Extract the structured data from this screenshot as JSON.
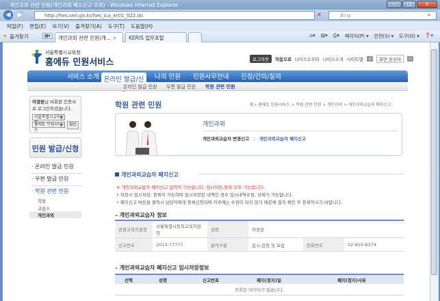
{
  "window": {
    "title": "개인과외 관련 민원(개인과외 폐소신고 조회) - Windows Internet Explorer",
    "controls": [
      "–",
      "□",
      "X"
    ]
  },
  "browser": {
    "url": "http://hes.sen.go.kr/hes_ica_er01_022.do",
    "search_placeholder": "Bing",
    "menu": [
      "파일(F)",
      "편집(E)",
      "보기(V)",
      "즐겨찾기(A)",
      "도구(T)",
      "도움말(H)"
    ],
    "favorites_label": "즐겨찾기",
    "tabs": [
      {
        "label": "개인과외 관련 민원(개...",
        "active": true
      },
      {
        "label": "KERIS 업무포탈",
        "active": false
      }
    ],
    "tools": [
      "페이지(P) ▾",
      "안전(S) ▾",
      "도구(O) ▾"
    ]
  },
  "site": {
    "org": "서울특별시교육청",
    "name": "홈에듀 민원서비스",
    "top_links": {
      "logout": "로그아웃",
      "links": [
        "처음으로",
        "나이스도우미",
        "나이스소개",
        "사이트맵"
      ],
      "zoom": "화면 원상태"
    },
    "gnb": [
      "서비스 소개",
      "온라인 발급/신청",
      "나의 민원",
      "민원사무안내",
      "진정/건의/질의"
    ],
    "gnb_active": 1,
    "snb": [
      "온라인 발급 민원",
      "우편 발급 민원",
      "학원 관련 민원"
    ],
    "login": {
      "user": "여경원",
      "message": "님 비회원 인증서로 로그인하셨습니다.",
      "select1": "서울특별시교육청",
      "select2": "홈에듀 민원서비스",
      "confirm": "확인"
    },
    "lnb_title": "민원 발급/신청",
    "lnb": [
      "온라인 발급 민원",
      "우편 발급 민원",
      "학원 관련 민원"
    ],
    "lnb_sub": [
      "학원",
      "교습소",
      "개인과외"
    ]
  },
  "main": {
    "title": "학원 관련 민원",
    "breadcrumb": "홈> 홈에듀 민원서비스 > 학원 관련 민원 > 개인과외 > 개인과외교습자 폐지신고",
    "banner": {
      "title": "개인과외",
      "link1": "개인과외교습자 변경신고",
      "sep": "|",
      "link2": "개인과외교습자 폐지신고"
    },
    "section": "개인과외교습자 폐지신고",
    "notice_red": "※ 개인과외교습자 폐지신고 입력이 가능합니다. 임시저장,등록 모두 가능합니다.",
    "notes": [
      "• 저장시 임시저장, 등록이 가능하며 임시저장된 내역인 경우 임시내역수정, 삭제가 가능합니다.",
      "• 폐지신고 버튼을 클릭시 담당자에게 등록신청되며 이후에는 수정이 되지 않기 때문에 필히 확인 후 등록하시기 바랍니다."
    ],
    "info_title": "개인과외교습자 정보",
    "info": {
      "office_label": "관할교육지원청",
      "office": "서울특별시동작교육지원청",
      "name_label": "성명",
      "name": "여경원",
      "regno_label": "신고번호",
      "regno": "2013-77777",
      "field_label": "분야구분",
      "field": "입시,검정 및 보습",
      "phone_label": "전화번호",
      "phone": "02-810-8374"
    },
    "temp_title": "개인과외교습자 폐지신고 임시저장정보",
    "temp_headers": [
      "선택",
      "성명",
      "신고번호",
      "폐지(정지)일",
      "폐지(정지)사유"
    ],
    "temp_empty": "조회된 데이타가 없습니다."
  }
}
